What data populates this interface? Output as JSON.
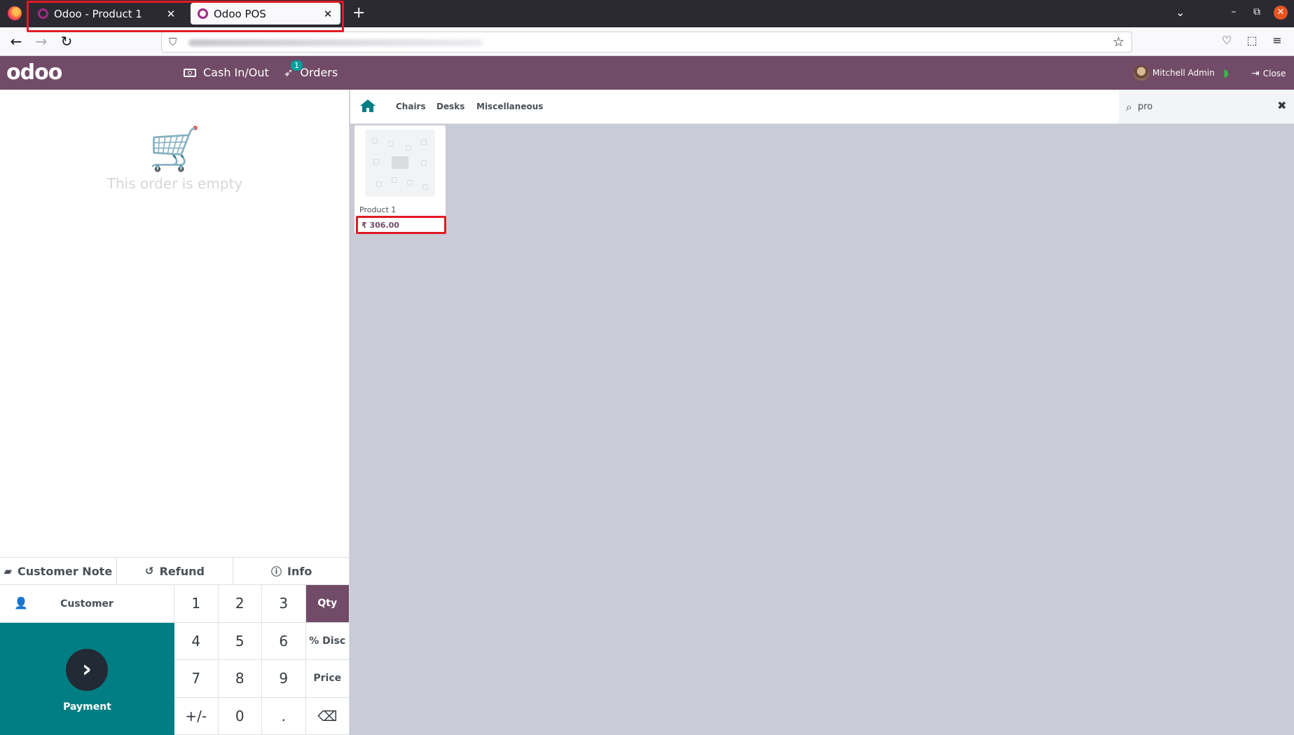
{
  "browser": {
    "tabs": [
      {
        "title": "Odoo - Product 1",
        "close": "✕"
      },
      {
        "title": "Odoo POS",
        "close": "✕"
      }
    ],
    "new_tab": "+",
    "tab_list": "⌄",
    "window": {
      "minimize": "–",
      "restore": "⧉",
      "close": "✕"
    },
    "nav": {
      "back": "←",
      "forward": "→",
      "reload": "↻"
    },
    "url_shield": "⛉",
    "bookmark": "☆",
    "toolbar": {
      "pocket": "♡",
      "extensions": "⬚",
      "menu": "≡"
    }
  },
  "header": {
    "logo": "odoo",
    "cash_label": "Cash In/Out",
    "orders_label": "Orders",
    "orders_count": "1",
    "orders_icon": "➶",
    "user_name": "Mitchell Admin",
    "wifi": "◗",
    "close_label": "Close",
    "close_icon": "⇥"
  },
  "order": {
    "cart_icon": "🛒",
    "empty_text": "This order is empty"
  },
  "controls": {
    "customer_note": "Customer Note",
    "refund": "Refund",
    "info": "Info",
    "note_icon": "▰",
    "refund_icon": "↺",
    "info_icon": "ⓘ"
  },
  "numpad": {
    "customer": "Customer",
    "customer_icon": "👤",
    "payment": "Payment",
    "payment_icon": "›",
    "keys": [
      "1",
      "2",
      "3",
      "Qty",
      "4",
      "5",
      "6",
      "% Disc",
      "7",
      "8",
      "9",
      "Price",
      "+/-",
      "0",
      ".",
      "⌫"
    ],
    "active_mode": "Qty"
  },
  "categories": [
    "Chairs",
    "Desks",
    "Miscellaneous"
  ],
  "search": {
    "value": "pro",
    "icon": "⌕",
    "clear": "✖"
  },
  "products": [
    {
      "name": "Product 1",
      "price": "₹ 306.00"
    }
  ],
  "colors": {
    "brand": "#714b67",
    "payment": "#017e84",
    "highlight": "#e01b24",
    "product_bg": "#c9ccd6"
  }
}
